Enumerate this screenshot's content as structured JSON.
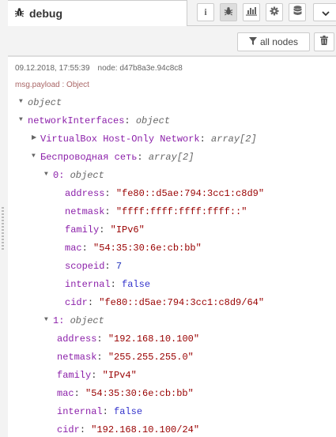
{
  "tab": {
    "title": "debug",
    "icon": "bug-icon"
  },
  "toolbar_icons": [
    "info-icon",
    "bug-icon",
    "chart-icon",
    "gear-icon",
    "database-icon"
  ],
  "filter": {
    "label": "all nodes",
    "icon": "filter-icon"
  },
  "clear_icon": "trash-icon",
  "message": {
    "timestamp": "09.12.2018, 17:55:39",
    "node": "node: d47b8a3e.94c8c8",
    "topic": "msg.payload : Object",
    "root_type": "object",
    "network_interfaces": {
      "key": "networkInterfaces",
      "type": "object",
      "virtualbox": {
        "key": "VirtualBox Host-Only Network",
        "type": "array[2]"
      },
      "wireless": {
        "key": "Беспроводная сеть",
        "type": "array[2]",
        "items": [
          {
            "index": "0",
            "type": "object",
            "address": "\"fe80::d5ae:794:3cc1:c8d9\"",
            "netmask": "\"ffff:ffff:ffff:ffff::\"",
            "family": "\"IPv6\"",
            "mac": "\"54:35:30:6e:cb:bb\"",
            "scopeid": "7",
            "internal": "false",
            "cidr": "\"fe80::d5ae:794:3cc1:c8d9/64\""
          },
          {
            "index": "1",
            "type": "object",
            "address": "\"192.168.10.100\"",
            "netmask": "\"255.255.255.0\"",
            "family": "\"IPv4\"",
            "mac": "\"54:35:30:6e:cb:bb\"",
            "internal": "false",
            "cidr": "\"192.168.10.100/24\""
          }
        ]
      }
    }
  }
}
